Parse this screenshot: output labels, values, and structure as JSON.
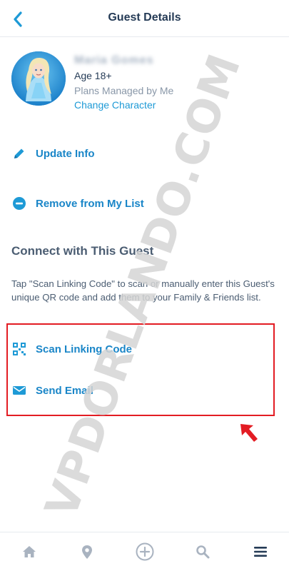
{
  "header": {
    "title": "Guest Details",
    "back_icon": "chevron-left-icon"
  },
  "profile": {
    "name": "Maria Gomes",
    "age": "Age 18+",
    "plans": "Plans Managed by Me",
    "change_character": "Change Character",
    "avatar_icon": "elsa-character-avatar"
  },
  "actions": {
    "update_info": "Update Info",
    "remove": "Remove from My List"
  },
  "connect": {
    "title": "Connect with This Guest",
    "description": "Tap \"Scan Linking Code\" to scan or manually enter this Guest's unique QR code and add them to your Family & Friends list.",
    "scan": "Scan Linking Code",
    "email": "Send Email"
  },
  "watermark": "VPDORLANDO.COM",
  "tabbar": {
    "icons": [
      "home-icon",
      "location-pin-icon",
      "add-circle-icon",
      "search-icon",
      "menu-icon"
    ]
  },
  "colors": {
    "accent": "#1a86c8",
    "text": "#253b56",
    "highlight": "#e31c23"
  }
}
